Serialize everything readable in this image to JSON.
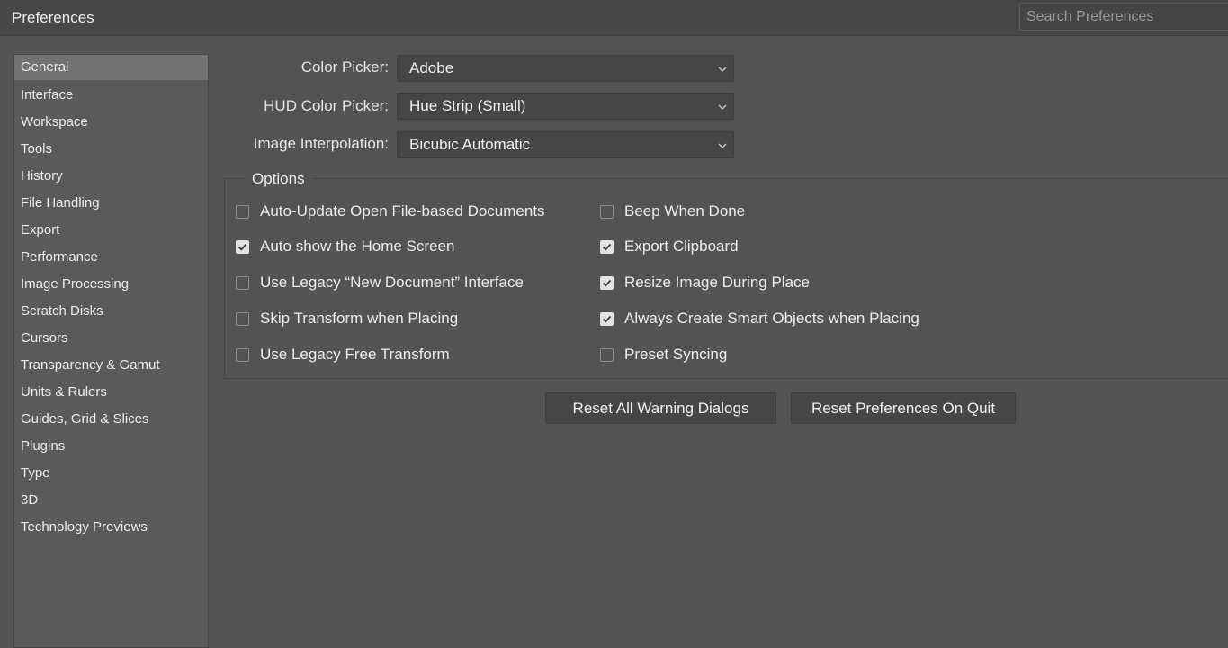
{
  "window": {
    "title": "Preferences"
  },
  "search": {
    "placeholder": "Search Preferences"
  },
  "sidebar": {
    "items": [
      {
        "label": "General",
        "selected": true
      },
      {
        "label": "Interface"
      },
      {
        "label": "Workspace"
      },
      {
        "label": "Tools"
      },
      {
        "label": "History"
      },
      {
        "label": "File Handling"
      },
      {
        "label": "Export"
      },
      {
        "label": "Performance"
      },
      {
        "label": "Image Processing"
      },
      {
        "label": "Scratch Disks"
      },
      {
        "label": "Cursors"
      },
      {
        "label": "Transparency & Gamut"
      },
      {
        "label": "Units & Rulers"
      },
      {
        "label": "Guides, Grid & Slices"
      },
      {
        "label": "Plugins"
      },
      {
        "label": "Type"
      },
      {
        "label": "3D"
      },
      {
        "label": "Technology Previews"
      }
    ]
  },
  "general": {
    "color_picker": {
      "label": "Color Picker:",
      "value": "Adobe"
    },
    "hud_color_picker": {
      "label": "HUD Color Picker:",
      "value": "Hue Strip (Small)"
    },
    "image_interpolation": {
      "label": "Image Interpolation:",
      "value": "Bicubic Automatic"
    },
    "options": {
      "legend": "Options",
      "left": [
        {
          "label": "Auto-Update Open File-based Documents",
          "checked": false
        },
        {
          "label": "Auto show the Home Screen",
          "checked": true
        },
        {
          "label": "Use Legacy “New Document” Interface",
          "checked": false
        },
        {
          "label": "Skip Transform when Placing",
          "checked": false
        },
        {
          "label": "Use Legacy Free Transform",
          "checked": false
        }
      ],
      "right": [
        {
          "label": "Beep When Done",
          "checked": false
        },
        {
          "label": "Export Clipboard",
          "checked": true
        },
        {
          "label": "Resize Image During Place",
          "checked": true
        },
        {
          "label": "Always Create Smart Objects when Placing",
          "checked": true
        },
        {
          "label": "Preset Syncing",
          "checked": false
        }
      ]
    },
    "buttons": {
      "reset_warnings": "Reset All Warning Dialogs",
      "reset_prefs": "Reset Preferences On Quit"
    }
  },
  "colors": {
    "background": "#535353",
    "titlebar": "#474747",
    "selected_item": "#727272",
    "control": "#464646"
  }
}
